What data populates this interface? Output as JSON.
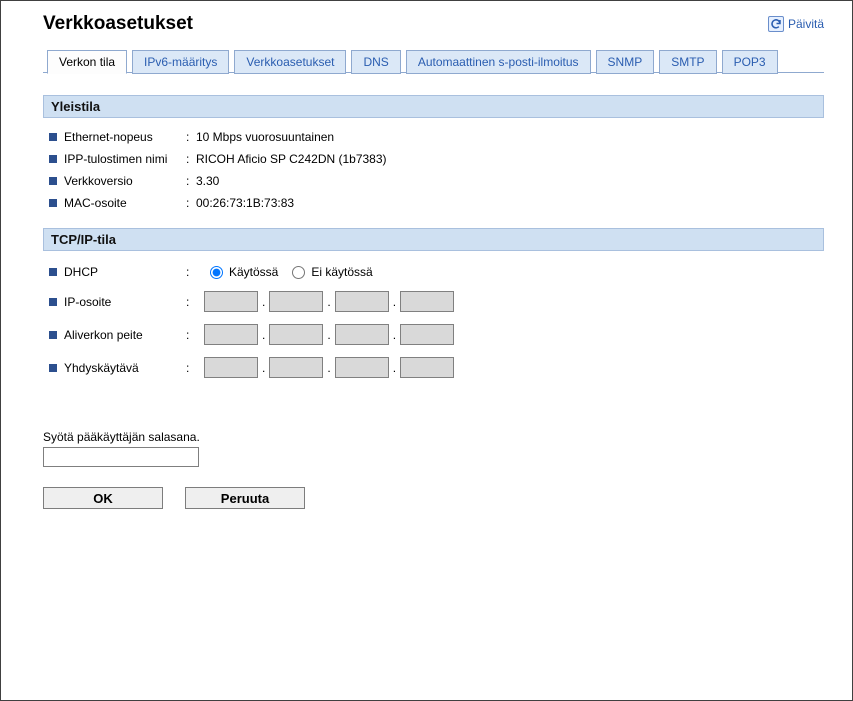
{
  "title": "Verkkoasetukset",
  "refresh_label": "Päivitä",
  "tabs": [
    {
      "label": "Verkon tila",
      "active": true
    },
    {
      "label": "IPv6-määritys",
      "active": false
    },
    {
      "label": "Verkkoasetukset",
      "active": false
    },
    {
      "label": "DNS",
      "active": false
    },
    {
      "label": "Automaattinen s-posti-ilmoitus",
      "active": false
    },
    {
      "label": "SNMP",
      "active": false
    },
    {
      "label": "SMTP",
      "active": false
    },
    {
      "label": "POP3",
      "active": false
    }
  ],
  "sections": {
    "general": {
      "heading": "Yleistila",
      "rows": [
        {
          "label": "Ethernet-nopeus",
          "value": "10 Mbps vuorosuuntainen"
        },
        {
          "label": "IPP-tulostimen nimi",
          "value": "RICOH Aficio SP C242DN (1b7383)"
        },
        {
          "label": "Verkkoversio",
          "value": "3.30"
        },
        {
          "label": "MAC-osoite",
          "value": "00:26:73:1B:73:83"
        }
      ]
    },
    "tcpip": {
      "heading": "TCP/IP-tila",
      "dhcp": {
        "label": "DHCP",
        "on_label": "Käytössä",
        "off_label": "Ei käytössä",
        "value": "on"
      },
      "ip": {
        "label": "IP-osoite",
        "o1": "",
        "o2": "",
        "o3": "",
        "o4": ""
      },
      "mask": {
        "label": "Aliverkon peite",
        "o1": "",
        "o2": "",
        "o3": "",
        "o4": ""
      },
      "gw": {
        "label": "Yhdyskäytävä",
        "o1": "",
        "o2": "",
        "o3": "",
        "o4": ""
      }
    }
  },
  "password": {
    "label": "Syötä pääkäyttäjän salasana.",
    "value": ""
  },
  "buttons": {
    "ok": "OK",
    "cancel": "Peruuta"
  },
  "colors": {
    "tab_bg": "#dbe8f7",
    "tab_border": "#8fa9cf",
    "link": "#2a5db0",
    "section_bg": "#cfe0f2",
    "bullet": "#2c4f8e"
  }
}
